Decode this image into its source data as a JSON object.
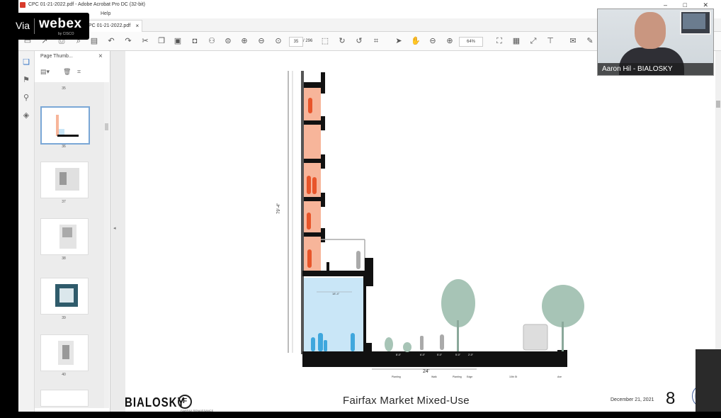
{
  "window": {
    "title": "CPC 01-21-2022.pdf - Adobe Acrobat Pro DC (32-bit)",
    "controls": "– □ ✕"
  },
  "menubar": {
    "help": "Help"
  },
  "tab": {
    "label": "PC 01-21-2022.pdf",
    "close": "×"
  },
  "toolbar": {
    "page_current": "35",
    "page_total": "/ 296",
    "zoom": "64%"
  },
  "thumb_panel": {
    "title": "Page Thumb...",
    "close": "×",
    "thumbs": [
      {
        "number": "35"
      },
      {
        "number": "36"
      },
      {
        "number": "37"
      },
      {
        "number": "38"
      },
      {
        "number": "39"
      },
      {
        "number": "40"
      }
    ]
  },
  "drawing": {
    "height_label": "79'-4\"",
    "street_width": "24'",
    "storefront_dim": "18'-4\"",
    "labels": [
      "Planting",
      "Walk",
      "Planting",
      "Edge",
      "10th St",
      "Ave"
    ],
    "small_dims": [
      "8'-0\"",
      "6'-0\"",
      "5'-0\"",
      "5'-0\"",
      "2'-0\""
    ]
  },
  "footer": {
    "logo": "BIALOSKY",
    "circle_logo": "F",
    "circle_small": "FAIRFAX RENAISSANCE",
    "title": "Fairfax Market Mixed-Use",
    "date": "December 21, 2021",
    "page": "8"
  },
  "webex": {
    "via": "Via",
    "brand": "webex",
    "cisco": "by CISCO"
  },
  "video": {
    "name": "Aaron Hil - BIALOSKY"
  },
  "colors": {
    "apartment_fill": "#f7b59a",
    "figure_orange": "#e8552a",
    "retail_fill": "#c9e6f7",
    "figure_blue": "#3fa7dd",
    "tree_green": "#a7c4b6",
    "structure": "#111111"
  }
}
